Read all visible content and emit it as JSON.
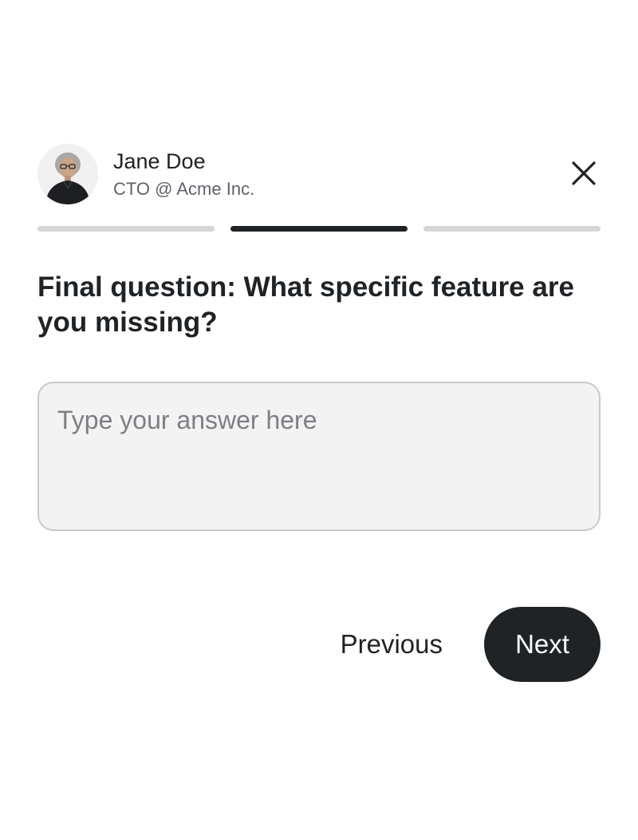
{
  "profile": {
    "name": "Jane Doe",
    "role": "CTO @ Acme Inc.",
    "avatar_icon": "avatar-photo"
  },
  "close": {
    "icon": "close-icon"
  },
  "progress": {
    "total_steps": 3,
    "current_step": 2
  },
  "question": {
    "text": "Final question: What specific feature are you missing?"
  },
  "answer": {
    "value": "",
    "placeholder": "Type your answer here"
  },
  "actions": {
    "previous_label": "Previous",
    "next_label": "Next"
  },
  "colors": {
    "primary": "#202326",
    "track": "#d6d6d6",
    "input_bg": "#f3f3f3",
    "input_border": "#c9c9c9",
    "secondary_text": "#5f6369"
  }
}
